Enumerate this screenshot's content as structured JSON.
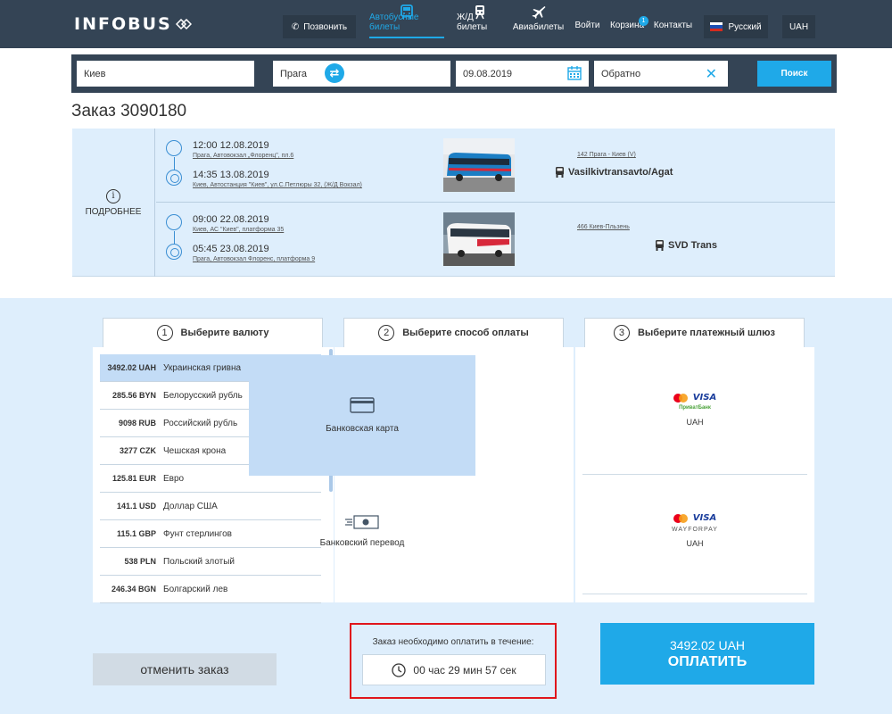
{
  "header": {
    "logo": "INFOBUS",
    "call_label": "Позвонить",
    "nav": [
      {
        "label": "Автобусные билеты",
        "icon": "bus-icon",
        "active": true
      },
      {
        "label": "Ж/Д билеты",
        "icon": "train-icon",
        "active": false
      },
      {
        "label": "Авиабилеты",
        "icon": "plane-icon",
        "active": false
      },
      {
        "label": "Войти"
      },
      {
        "label": "Корзина",
        "badge": "1"
      },
      {
        "label": "Контакты"
      }
    ],
    "language": "Русский",
    "currency": "UAH"
  },
  "search": {
    "from": "Киев",
    "to": "Прага",
    "date": "09.08.2019",
    "return": "Обратно",
    "button": "Поиск"
  },
  "order": {
    "title": "Заказ 3090180",
    "details_label": "ПОДРОБНЕЕ",
    "legs": [
      {
        "depart_time": "12:00  12.08.2019",
        "depart_place": "Прага, Автовокзал „Флоренц\", пл.6",
        "arrive_time": "14:35  13.08.2019",
        "arrive_place": "Киев, Автостанция \"Киев\", ул.С.Петлюры 32, (Ж/Д Вокзал)",
        "route": "142 Прага - Киев (V)",
        "carrier": "Vasilkivtransavto/Agat"
      },
      {
        "depart_time": "09:00  22.08.2019",
        "depart_place": "Киев, АС \"Киев\", платформа 35",
        "arrive_time": "05:45  23.08.2019",
        "arrive_place": "Прага, Автовокзал Флоренс, платформа 9",
        "route": "466 Киев-Пльзень",
        "carrier": "SVD Trans"
      }
    ]
  },
  "payment": {
    "steps": [
      {
        "num": "1",
        "label": "Выберите валюту"
      },
      {
        "num": "2",
        "label": "Выберите способ оплаты"
      },
      {
        "num": "3",
        "label": "Выберите платежный шлюз"
      }
    ],
    "currencies": [
      {
        "amount": "3492.02 UAH",
        "name": "Украинская гривна",
        "selected": true
      },
      {
        "amount": "285.56 BYN",
        "name": "Белорусский рубль"
      },
      {
        "amount": "9098 RUB",
        "name": "Российский рубль"
      },
      {
        "amount": "3277 CZK",
        "name": "Чешская крона"
      },
      {
        "amount": "125.81 EUR",
        "name": "Евро"
      },
      {
        "amount": "141.1 USD",
        "name": "Доллар США"
      },
      {
        "amount": "115.1 GBP",
        "name": "Фунт стерлингов"
      },
      {
        "amount": "538 PLN",
        "name": "Польский злотый"
      },
      {
        "amount": "246.34 BGN",
        "name": "Болгарский лев"
      }
    ],
    "methods": {
      "card": "Банковская карта",
      "transfer": "Банковский перевод"
    },
    "gateways": [
      {
        "visa": "VISA",
        "brand": "ПриватБанк",
        "currency": "UAH"
      },
      {
        "visa": "VISA",
        "brand": "WAYFORPAY",
        "currency": "UAH"
      }
    ],
    "cancel_label": "отменить заказ",
    "timer_label": "Заказ необходимо оплатить в течение:",
    "timer_value": "00 час 29 мин 57 сек",
    "pay_amount": "3492.02 UAH",
    "pay_label": "ОПЛАТИТЬ"
  },
  "colors": {
    "accent": "#1fa9e8",
    "header": "#344455",
    "light_bg": "#deeefc",
    "alert": "#e0161c"
  }
}
